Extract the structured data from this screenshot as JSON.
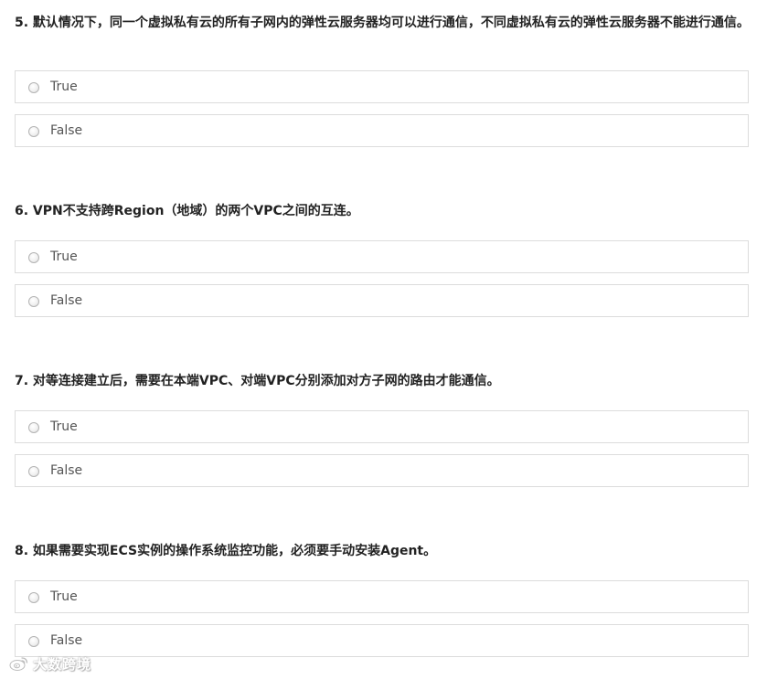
{
  "questions": [
    {
      "title": "5. 默认情况下，同一个虚拟私有云的所有子网内的弹性云服务器均可以进行通信，不同虚拟私有云的弹性云服务器不能进行通信。",
      "options": [
        "True",
        "False"
      ]
    },
    {
      "title": "6. VPN不支持跨Region（地域）的两个VPC之间的互连。",
      "options": [
        "True",
        "False"
      ]
    },
    {
      "title": "7. 对等连接建立后，需要在本端VPC、对端VPC分别添加对方子网的路由才能通信。",
      "options": [
        "True",
        "False"
      ]
    },
    {
      "title": "8. 如果需要实现ECS实例的操作系统监控功能，必须要手动安装Agent。",
      "options": [
        "True",
        "False"
      ]
    }
  ],
  "watermark": {
    "icon": "weibo-logo-icon",
    "text": "大数跨境"
  },
  "colors": {
    "border": "#dcdcdc",
    "title_text": "#222222",
    "option_text": "#555555"
  }
}
